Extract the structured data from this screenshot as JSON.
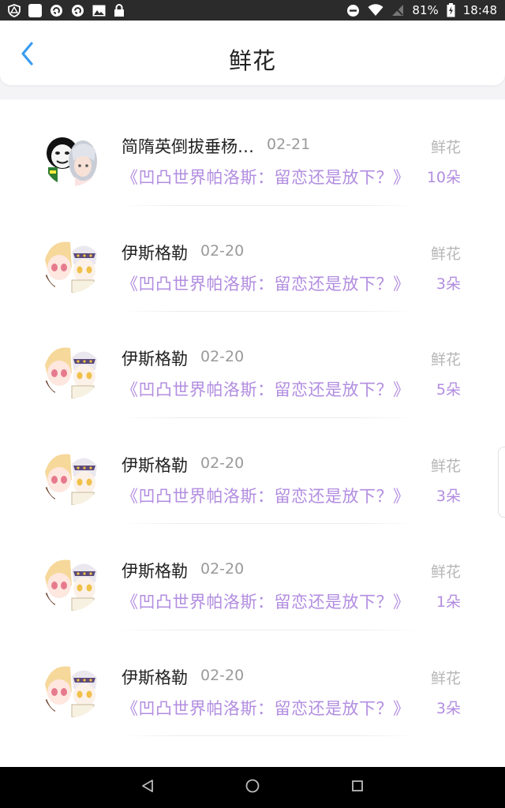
{
  "status_bar": {
    "battery": "81%",
    "time": "18:48"
  },
  "header": {
    "title": "鲜花"
  },
  "list": [
    {
      "user": "简隋英倒拔垂杨…",
      "date": "02-21",
      "title": "《凹凸世界帕洛斯：留恋还是放下？》",
      "gift": "鲜花",
      "count": "10朵",
      "avatar": "meme"
    },
    {
      "user": "伊斯格勒",
      "date": "02-20",
      "title": "《凹凸世界帕洛斯：留恋还是放下？》",
      "gift": "鲜花",
      "count": "3朵",
      "avatar": "anime"
    },
    {
      "user": "伊斯格勒",
      "date": "02-20",
      "title": "《凹凸世界帕洛斯：留恋还是放下？》",
      "gift": "鲜花",
      "count": "5朵",
      "avatar": "anime"
    },
    {
      "user": "伊斯格勒",
      "date": "02-20",
      "title": "《凹凸世界帕洛斯：留恋还是放下？》",
      "gift": "鲜花",
      "count": "3朵",
      "avatar": "anime"
    },
    {
      "user": "伊斯格勒",
      "date": "02-20",
      "title": "《凹凸世界帕洛斯：留恋还是放下？》",
      "gift": "鲜花",
      "count": "1朵",
      "avatar": "anime"
    },
    {
      "user": "伊斯格勒",
      "date": "02-20",
      "title": "《凹凸世界帕洛斯：留恋还是放下？》",
      "gift": "鲜花",
      "count": "3朵",
      "avatar": "anime"
    }
  ],
  "colors": {
    "accent_purple": "#b28de0",
    "back_blue": "#3a9cf0",
    "status_bg": "#2b2b2b",
    "nav_bg": "#000000"
  },
  "icons": {
    "back": "chevron-left-icon",
    "nav_back": "triangle-back-icon",
    "nav_home": "circle-home-icon",
    "nav_recents": "square-recents-icon"
  }
}
